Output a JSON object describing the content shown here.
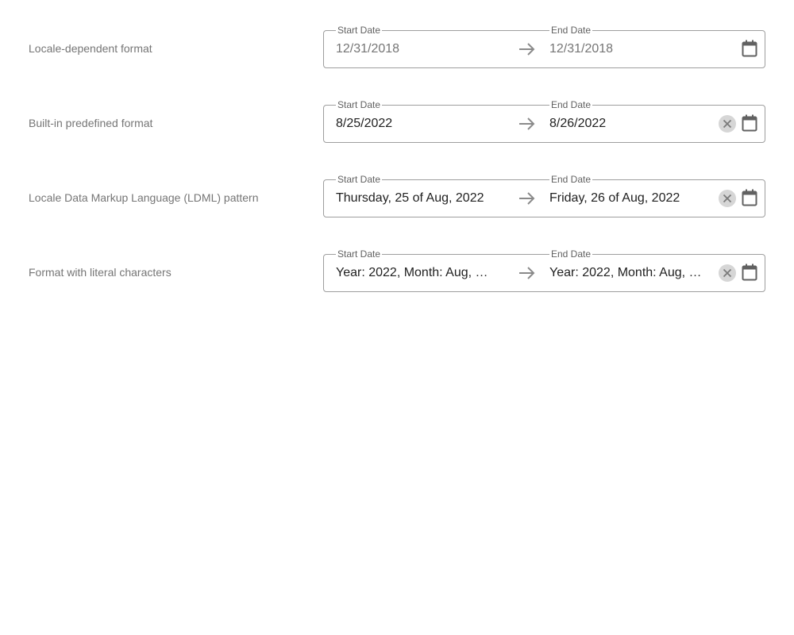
{
  "rows": [
    {
      "label": "Locale-dependent format",
      "start_label": "Start Date",
      "end_label": "End Date",
      "start_value": "12/31/2018",
      "end_value": "12/31/2018",
      "arrow_icon": "arrow-right-icon",
      "calendar_icon": "calendar-icon"
    },
    {
      "label": "Built-in predefined format",
      "start_label": "Start Date",
      "end_label": "End Date",
      "start_value": "8/25/2022",
      "end_value": "8/26/2022",
      "arrow_icon": "arrow-right-icon",
      "clear_icon": "clear-icon",
      "calendar_icon": "calendar-icon"
    },
    {
      "label": "Locale Data Markup Language (LDML) pattern",
      "start_label": "Start Date",
      "end_label": "End Date",
      "start_value": "Thursday, 25 of Aug, 2022",
      "end_value": "Friday, 26 of Aug, 2022",
      "arrow_icon": "arrow-right-icon",
      "clear_icon": "clear-icon",
      "calendar_icon": "calendar-icon"
    },
    {
      "label": "Format with literal characters",
      "start_label": "Start Date",
      "end_label": "End Date",
      "start_value": "Year: 2022, Month: Aug, D…",
      "end_value": "Year: 2022, Month: Aug, D…",
      "arrow_icon": "arrow-right-icon",
      "clear_icon": "clear-icon",
      "calendar_icon": "calendar-icon"
    }
  ],
  "colors": {
    "border": "#9e9e9e",
    "label_text": "#757575",
    "value_text": "#212121",
    "icon": "#757575",
    "clear_bg": "#d6d6d6"
  }
}
